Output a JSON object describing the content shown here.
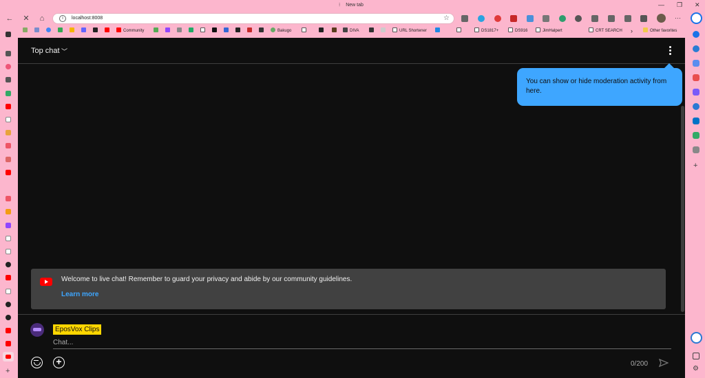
{
  "browser": {
    "tab_title": "New tab",
    "address": "localhost:8008"
  },
  "bookmarks": [
    "Community",
    "Bakugo",
    "DIVA",
    "URL Shortener",
    "DS1817+",
    "DS916",
    "JimHalpert",
    "CRT SEARCH",
    "Other favorites"
  ],
  "chat": {
    "header_title": "Top chat",
    "tooltip_text": "You can show or hide moderation activity from here.",
    "welcome_text": "Welcome to live chat! Remember to guard your privacy and abide by our community guidelines.",
    "learn_more": "Learn more",
    "username": "EposVox Clips",
    "input_placeholder": "Chat...",
    "char_counter": "0/200"
  },
  "colors": {
    "browser_chrome": "#fcb6cd",
    "chat_bg": "#0f0f0f",
    "accent_blue": "#3ea6ff",
    "youtube_red": "#ff0000",
    "username_badge": "#ffd600"
  }
}
